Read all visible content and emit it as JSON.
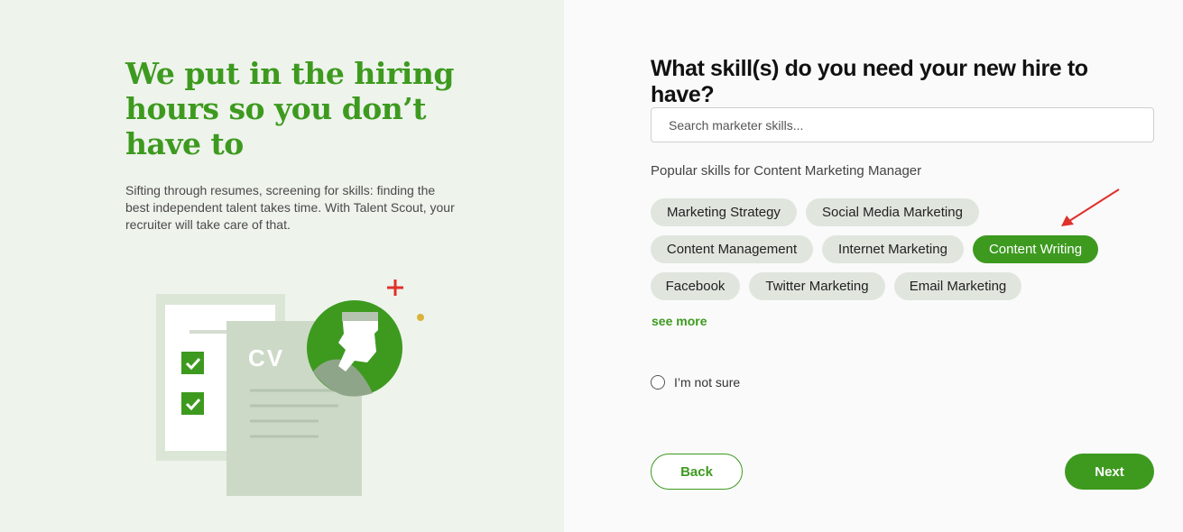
{
  "left_panel": {
    "headline": "We put in the hiring hours so you don’t have to",
    "subtext": "Sifting through resumes, screening for skills: finding the best independent talent takes time. With Talent Scout, your recruiter will take care of that.",
    "illustration": {
      "cv_label": "CV"
    }
  },
  "form": {
    "question": "What skill(s) do you need your new hire to have?",
    "search": {
      "placeholder": "Search marketer skills...",
      "value": ""
    },
    "popular_label": "Popular skills for Content Marketing Manager",
    "skills": [
      {
        "label": "Marketing Strategy",
        "selected": false
      },
      {
        "label": "Social Media Marketing",
        "selected": false
      },
      {
        "label": "Content Management",
        "selected": false
      },
      {
        "label": "Internet Marketing",
        "selected": false
      },
      {
        "label": "Content Writing",
        "selected": true
      },
      {
        "label": "Facebook",
        "selected": false
      },
      {
        "label": "Twitter Marketing",
        "selected": false
      },
      {
        "label": "Email Marketing",
        "selected": false
      }
    ],
    "see_more": "see more",
    "not_sure_label": "I’m not sure",
    "back_label": "Back",
    "next_label": "Next"
  },
  "colors": {
    "brand_green": "#3d9a1f",
    "left_bg": "#eef3ec",
    "chip_bg": "#e0e6de",
    "annotation_red": "#e0302a"
  }
}
